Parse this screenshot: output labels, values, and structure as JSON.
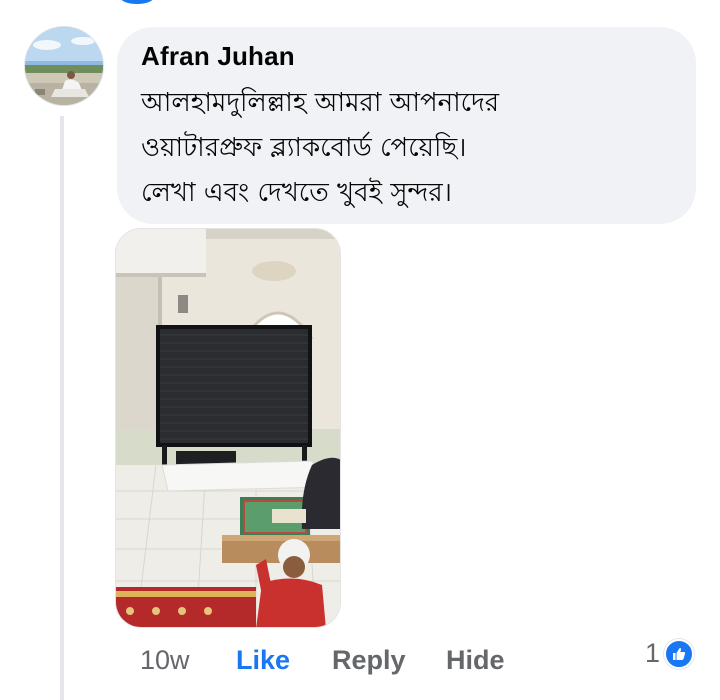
{
  "comment": {
    "author": "Afran Juhan",
    "text_lines": [
      "আলহামদুলিল্লাহ আমরা আপনাদের",
      "ওয়াটারপ্রুফ ব্ল্যাকবোর্ড  পেয়েছি।",
      "লেখা এবং দেখতে খুবই সুন্দর।"
    ]
  },
  "actions": {
    "time": "10w",
    "like_label": "Like",
    "reply_label": "Reply",
    "hide_label": "Hide"
  },
  "reactions": {
    "count": "1",
    "icon": "like-thumb-icon"
  },
  "colors": {
    "accent": "#1877f2",
    "secondary_text": "#65676b",
    "bubble": "#f0f2f5"
  }
}
